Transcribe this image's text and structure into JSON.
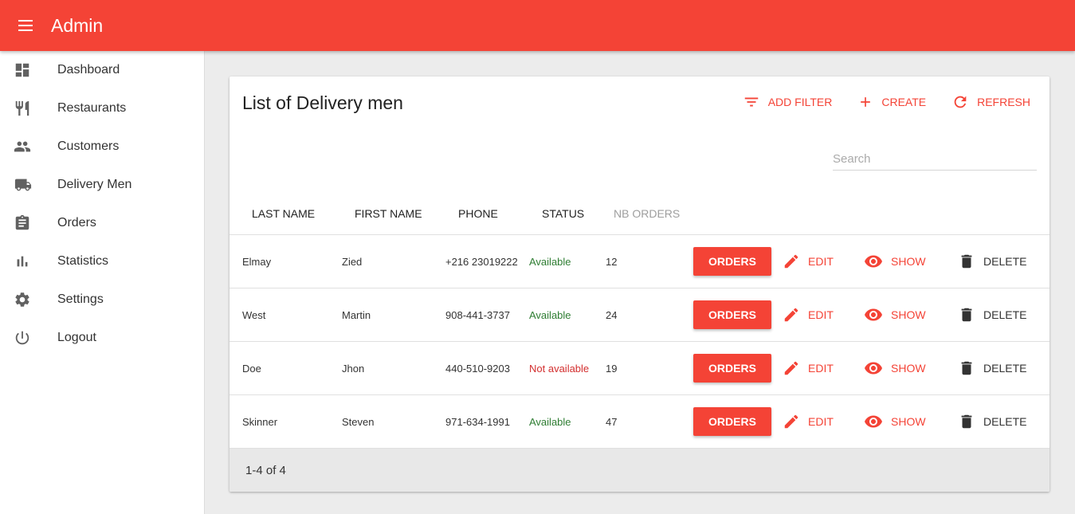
{
  "app": {
    "title": "Admin"
  },
  "sidebar": {
    "items": [
      {
        "label": "Dashboard",
        "icon": "dashboard-icon"
      },
      {
        "label": "Restaurants",
        "icon": "restaurant-icon"
      },
      {
        "label": "Customers",
        "icon": "people-icon"
      },
      {
        "label": "Delivery Men",
        "icon": "truck-icon"
      },
      {
        "label": "Orders",
        "icon": "clipboard-icon"
      },
      {
        "label": "Statistics",
        "icon": "bar-chart-icon"
      },
      {
        "label": "Settings",
        "icon": "gear-icon"
      },
      {
        "label": "Logout",
        "icon": "power-icon"
      }
    ]
  },
  "page": {
    "title": "List of Delivery men",
    "actions": {
      "add_filter": "ADD FILTER",
      "create": "CREATE",
      "refresh": "REFRESH"
    },
    "search": {
      "placeholder": "Search",
      "value": ""
    }
  },
  "table": {
    "headers": {
      "last_name": "LAST NAME",
      "first_name": "FIRST NAME",
      "phone": "PHONE",
      "status": "STATUS",
      "nb_orders": "NB ORDERS"
    },
    "actions": {
      "orders": "ORDERS",
      "edit": "EDIT",
      "show": "SHOW",
      "delete": "DELETE"
    },
    "rows": [
      {
        "last_name": "Elmay",
        "first_name": "Zied",
        "phone": "+216 23019222",
        "status": "Available",
        "nb_orders": "12"
      },
      {
        "last_name": "West",
        "first_name": "Martin",
        "phone": "908-441-3737",
        "status": "Available",
        "nb_orders": "24"
      },
      {
        "last_name": "Doe",
        "first_name": "Jhon",
        "phone": "440-510-9203",
        "status": "Not available",
        "nb_orders": "19"
      },
      {
        "last_name": "Skinner",
        "first_name": "Steven",
        "phone": "971-634-1991",
        "status": "Available",
        "nb_orders": "47"
      }
    ]
  },
  "pagination": {
    "text": "1-4 of 4"
  },
  "colors": {
    "primary": "#f44336",
    "available": "#2e7d32",
    "not_available": "#d32f2f"
  }
}
